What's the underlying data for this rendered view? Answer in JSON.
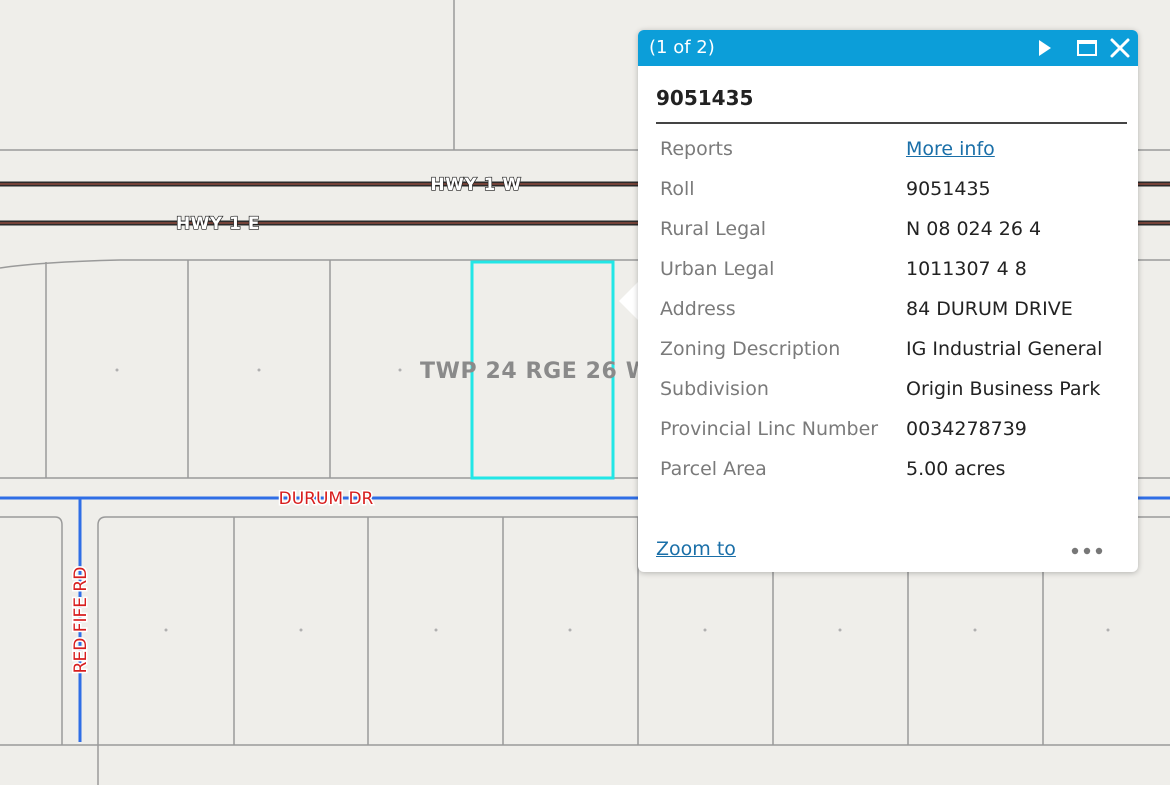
{
  "map": {
    "roads": {
      "hwy_1_w": "HWY 1 W",
      "hwy_1_e": "HWY 1 E",
      "durum_dr": "DURUM DR",
      "red_fife_rd": "RED FIFE RD"
    },
    "township_label": "TWP 24 RGE 26 W",
    "colors": {
      "background": "#efeeea",
      "parcel_line": "#9a9a9a",
      "street_blue": "#2f6ee6",
      "selection": "#22e6e6",
      "street_label": "#d81e1e"
    }
  },
  "popup": {
    "count_label": "(1 of 2)",
    "title": "9051435",
    "icons": {
      "next": "play-icon",
      "maximize": "maximize-icon",
      "close": "close-icon",
      "more": "ellipsis-icon"
    },
    "fields": [
      {
        "key": "Reports",
        "value": "More info",
        "is_link": true
      },
      {
        "key": "Roll",
        "value": "9051435"
      },
      {
        "key": "Rural Legal",
        "value": "N 08 024 26 4"
      },
      {
        "key": "Urban Legal",
        "value": "1011307 4 8"
      },
      {
        "key": "Address",
        "value": "84 DURUM DRIVE"
      },
      {
        "key": "Zoning Description",
        "value": "IG Industrial General"
      },
      {
        "key": "Subdivision",
        "value": "Origin Business Park"
      },
      {
        "key": "Provincial Linc Number",
        "value": "0034278739"
      },
      {
        "key": "Parcel Area",
        "value": "5.00 acres"
      }
    ],
    "zoom_label": "Zoom to"
  }
}
